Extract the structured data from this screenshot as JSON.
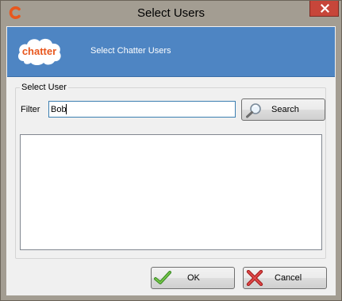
{
  "window": {
    "title": "Select Users",
    "app_icon": "c-app-icon",
    "close_icon": "close-icon"
  },
  "banner": {
    "logo_text": "chatter",
    "subtitle": "Select Chatter Users",
    "logo_icon": "chatter-cloud-logo",
    "background_color": "#4e85c3"
  },
  "select_user": {
    "legend": "Select User",
    "filter_label": "Filter",
    "filter_value": "Bob",
    "search_button": {
      "label": "Search",
      "icon": "magnifier-icon"
    },
    "results": []
  },
  "footer": {
    "ok_button": {
      "label": "OK",
      "icon": "checkmark-icon"
    },
    "cancel_button": {
      "label": "Cancel",
      "icon": "x-cross-icon"
    }
  },
  "colors": {
    "frame": "#a39d92",
    "close_button": "#c7463a",
    "accent_orange": "#e8571e"
  }
}
